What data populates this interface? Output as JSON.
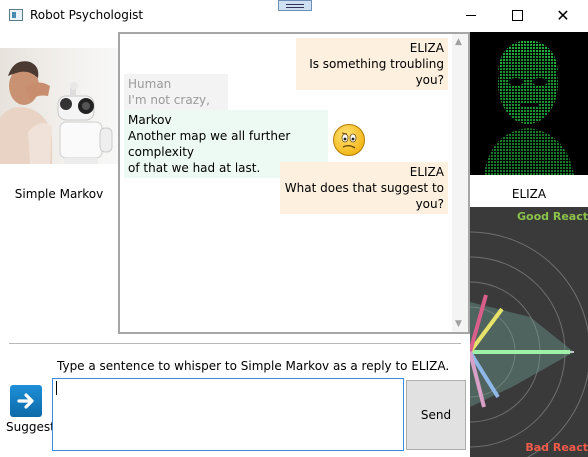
{
  "window": {
    "title": "Robot Psychologist",
    "icons": {
      "app": "window-app-icon",
      "minimize": "minimize-icon",
      "maximize": "maximize-icon",
      "close": "close-icon",
      "grip": "drag-grip-icon"
    }
  },
  "left_panel": {
    "image": "man-whispering-to-robot-photo",
    "label": "Simple Markov"
  },
  "chat": {
    "messages": [
      {
        "speaker": "ELIZA",
        "text": "Is something troubling you?"
      },
      {
        "speaker": "Human",
        "text": "I'm not crazy, doc."
      },
      {
        "speaker": "Markov",
        "text": "Another map we all further complexity of that we had at last.",
        "line1": "Another map we all further complexity",
        "line2": "of that we had at last.",
        "emoji": "confused-face-emoji"
      },
      {
        "speaker": "ELIZA",
        "text": "What does that suggest to you?"
      }
    ]
  },
  "right_panel": {
    "image": "matrix-green-face-portrait",
    "label": "ELIZA",
    "graph": {
      "top_label": "Good React",
      "bottom_label": "Bad React"
    }
  },
  "input_area": {
    "instruction": "Type a sentence to whisper to Simple Markov as a reply to ELIZA.",
    "suggest_label": "Suggest",
    "suggest_icon": "arrow-right-icon",
    "input_value": "",
    "send_label": "Send"
  },
  "colors": {
    "eliza_bubble": "#fdf0df",
    "markov_bubble": "#edfaf3",
    "human_bubble": "#f3f3f3",
    "good": "#8bc34a",
    "bad": "#f25a4a",
    "input_border": "#3b8be0"
  }
}
